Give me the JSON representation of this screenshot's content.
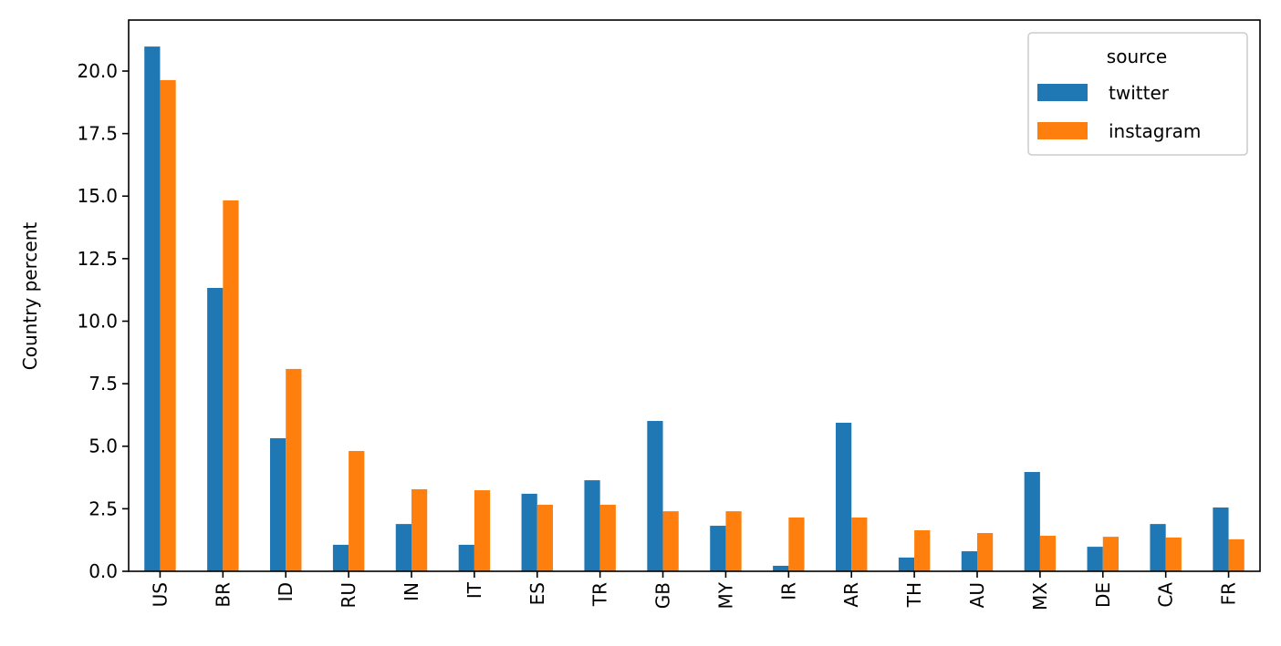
{
  "chart_data": {
    "type": "bar",
    "title": "",
    "xlabel": "",
    "ylabel": "Country percent",
    "ylim": [
      0,
      22.04
    ],
    "yticks": [
      "0.0",
      "2.5",
      "5.0",
      "7.5",
      "10.0",
      "12.5",
      "15.0",
      "17.5",
      "20.0"
    ],
    "ytick_values": [
      0,
      2.5,
      5,
      7.5,
      10,
      12.5,
      15,
      17.5,
      20
    ],
    "grid": false,
    "categories": [
      "US",
      "BR",
      "ID",
      "RU",
      "IN",
      "IT",
      "ES",
      "TR",
      "GB",
      "MY",
      "IR",
      "AR",
      "TH",
      "AU",
      "MX",
      "DE",
      "CA",
      "FR"
    ],
    "series": [
      {
        "name": "twitter",
        "color": "#1f77b4",
        "values": [
          20.98,
          11.33,
          5.32,
          1.06,
          1.89,
          1.06,
          3.1,
          3.64,
          6.01,
          1.82,
          0.22,
          5.94,
          0.55,
          0.8,
          3.97,
          0.98,
          1.89,
          2.55
        ]
      },
      {
        "name": "instagram",
        "color": "#ff7f0e",
        "values": [
          19.64,
          14.83,
          8.09,
          4.81,
          3.28,
          3.24,
          2.66,
          2.66,
          2.4,
          2.4,
          2.15,
          2.15,
          1.64,
          1.53,
          1.42,
          1.38,
          1.35,
          1.28
        ]
      }
    ],
    "legend": {
      "title": "source",
      "position": "top-right",
      "entries": [
        "twitter",
        "instagram"
      ]
    }
  }
}
